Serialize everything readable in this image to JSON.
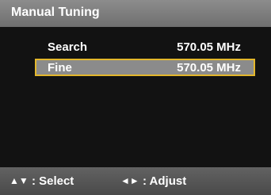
{
  "header": {
    "title": "Manual Tuning"
  },
  "menu": {
    "items": [
      {
        "label": "Search",
        "value": "570.05 MHz",
        "selected": false
      },
      {
        "label": "Fine",
        "value": "570.05 MHz",
        "selected": true
      }
    ]
  },
  "footer": {
    "select_icons": "▲▼",
    "select_label": ": Select",
    "adjust_icons": "◄►",
    "adjust_label": ": Adjust"
  },
  "colors": {
    "title_bar": "#7d7d7d",
    "background": "#121212",
    "selected_row": "#8b8b8b",
    "selection_border": "#e3b72c",
    "footer": "#565656"
  }
}
